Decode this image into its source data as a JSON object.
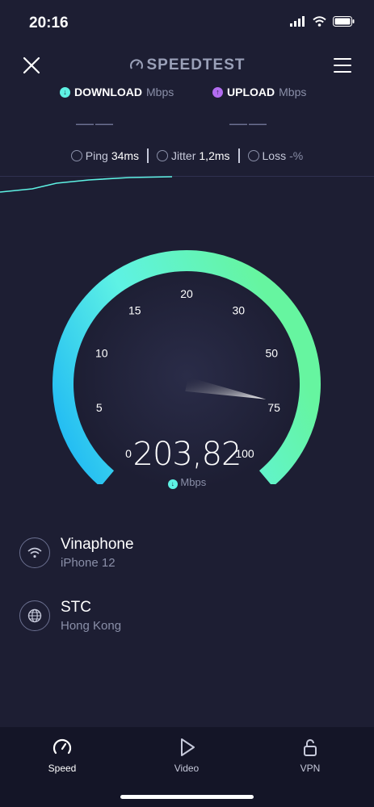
{
  "status_bar": {
    "time": "20:16"
  },
  "header": {
    "app_title": "SPEEDTEST"
  },
  "metrics": {
    "download": {
      "label": "DOWNLOAD",
      "unit": "Mbps",
      "value": "——"
    },
    "upload": {
      "label": "UPLOAD",
      "unit": "Mbps",
      "value": "——"
    }
  },
  "stats": {
    "ping": {
      "label": "Ping",
      "value": "34ms"
    },
    "jitter": {
      "label": "Jitter",
      "value": "1,2ms"
    },
    "loss": {
      "label": "Loss",
      "value": "-%"
    }
  },
  "gauge": {
    "ticks": [
      "0",
      "5",
      "10",
      "15",
      "20",
      "30",
      "50",
      "75",
      "100"
    ],
    "current_speed": "203,82",
    "unit": "Mbps",
    "needle_level": 0.86
  },
  "connection": {
    "provider": "Vinaphone",
    "device": "iPhone 12",
    "server_name": "STC",
    "server_location": "Hong Kong"
  },
  "tabs": [
    {
      "label": "Speed",
      "icon": "speed-gauge-icon"
    },
    {
      "label": "Video",
      "icon": "play-icon"
    },
    {
      "label": "VPN",
      "icon": "lock-icon"
    }
  ],
  "colors": {
    "background": "#1d1e33",
    "accent_cyan": "#5ef2e4",
    "accent_green": "#66f5a0",
    "upload_purple": "#b26cf0"
  }
}
